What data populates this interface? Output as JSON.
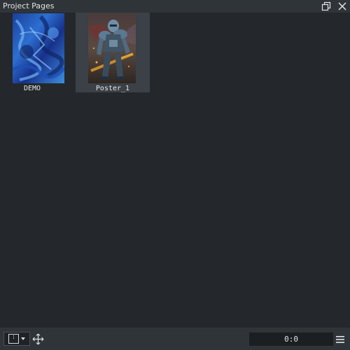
{
  "window": {
    "title": "Project Pages",
    "buttons": {
      "float_icon": "restore-window-icon",
      "close_icon": "close-icon"
    }
  },
  "pages": [
    {
      "label": "DEMO",
      "selected": false,
      "thumbnail": "blue-abstract-painting"
    },
    {
      "label": "Poster_1",
      "selected": true,
      "thumbnail": "armored-warrior-artwork"
    }
  ],
  "footer": {
    "view_dropdown_icon": "page-view-icon",
    "move_icon": "move-arrows-icon",
    "zoom_readout": "0:0",
    "menu_icon": "hamburger-menu-icon"
  },
  "colors": {
    "background": "#24282c",
    "titlebar": "#2f3438",
    "selection": "#3b4146",
    "text": "#e2e4e6"
  }
}
